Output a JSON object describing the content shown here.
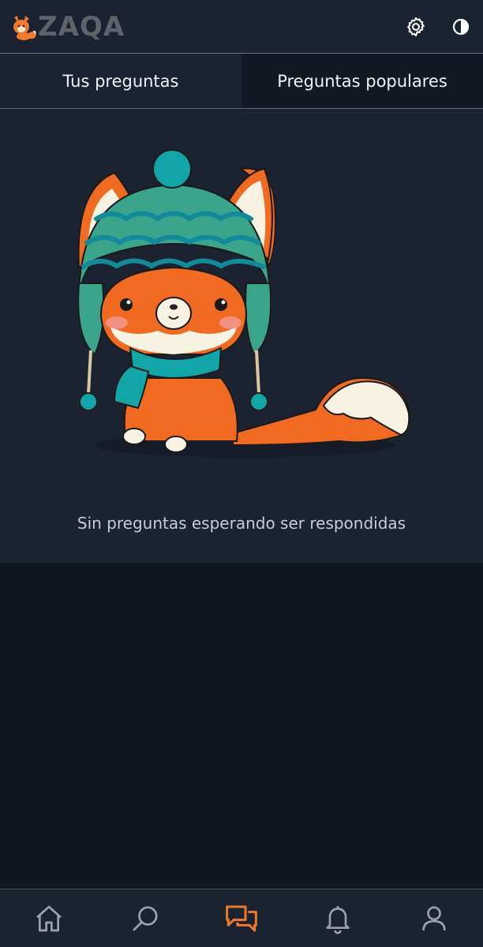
{
  "app": {
    "logo_text": "ZAQA"
  },
  "colors": {
    "accent": "#f07a2a",
    "background": "#121822",
    "surface": "#1b2230",
    "icon": "#9ea3ab"
  },
  "header": {
    "icons": [
      "gear-icon",
      "contrast-icon"
    ]
  },
  "tabs": [
    {
      "label": "Tus preguntas",
      "active": true
    },
    {
      "label": "Preguntas populares",
      "active": false
    }
  ],
  "empty_state": {
    "message": "Sin preguntas esperando ser respondidas",
    "illustration": "fox-in-winter-hat"
  },
  "bottom_nav": [
    {
      "icon": "home-icon",
      "active": false
    },
    {
      "icon": "search-icon",
      "active": false
    },
    {
      "icon": "chat-icon",
      "active": true
    },
    {
      "icon": "bell-icon",
      "active": false
    },
    {
      "icon": "user-icon",
      "active": false
    }
  ]
}
